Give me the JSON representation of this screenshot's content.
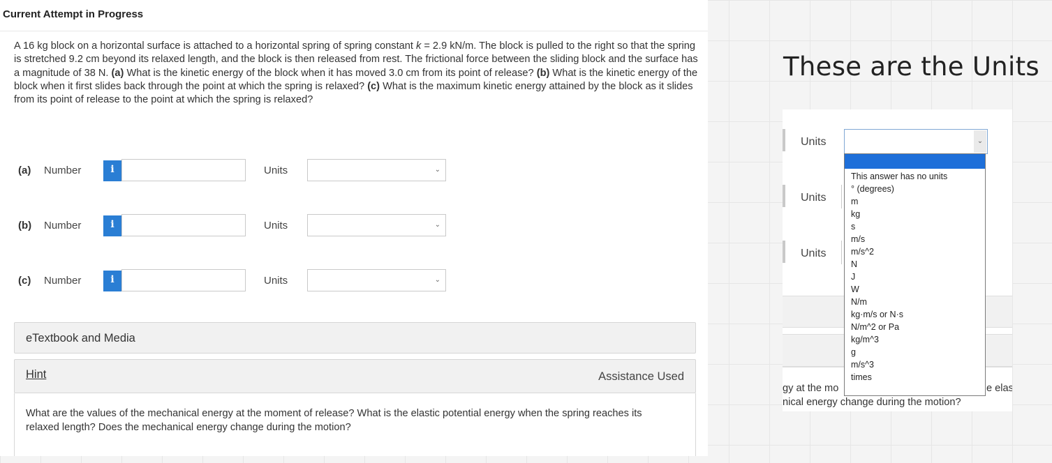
{
  "title": "Current Attempt in Progress",
  "problem": {
    "p1": "A 16 kg block on a horizontal surface is attached to a horizontal spring of spring constant ",
    "k_var": "k",
    "p2": " = 2.9 kN/m. The block is pulled to the right so that the spring is stretched 9.2 cm beyond its relaxed length, and the block is then released from rest. The frictional force between the sliding block and the surface has a magnitude of 38 N. ",
    "a_mark": "(a)",
    "a_text": " What is the kinetic energy of the block when it has moved 3.0 cm from its point of release? ",
    "b_mark": "(b)",
    "b_text": " What is the kinetic energy of the block when it first slides back through the point at which the spring is relaxed? ",
    "c_mark": "(c)",
    "c_text": " What is the maximum kinetic energy attained by the block as it slides from its point of release to the point at which the spring is relaxed?"
  },
  "parts": [
    {
      "letter": "(a)",
      "number_label": "Number",
      "info_icon": "i",
      "number_value": "",
      "units_label": "Units",
      "units_value": ""
    },
    {
      "letter": "(b)",
      "number_label": "Number",
      "info_icon": "i",
      "number_value": "",
      "units_label": "Units",
      "units_value": ""
    },
    {
      "letter": "(c)",
      "number_label": "Number",
      "info_icon": "i",
      "number_value": "",
      "units_label": "Units",
      "units_value": ""
    }
  ],
  "etextbook": {
    "label": "eTextbook and Media"
  },
  "hint": {
    "label": "Hint",
    "status": "Assistance Used",
    "text": "What are the values of the mechanical energy at the moment of release? What is the elastic potential energy when the spring reaches its relaxed length? Does the mechanical energy change during the motion?"
  },
  "zoom": {
    "heading": "These are the Units",
    "units_label": "Units",
    "frag_left_1": "gy at the mo",
    "frag_right_1": "e elas",
    "frag_2": "nical energy change during the motion?"
  },
  "dropdown": {
    "selected": "",
    "options": [
      "This answer has no units",
      "° (degrees)",
      "m",
      "kg",
      "s",
      "m/s",
      "m/s^2",
      "N",
      "J",
      "W",
      "N/m",
      "kg·m/s or N·s",
      "N/m^2 or Pa",
      "kg/m^3",
      "g",
      "m/s^3",
      "times"
    ]
  },
  "colors": {
    "info_button": "#2a7ed4",
    "dropdown_highlight": "#1e6fd9",
    "panel_gray": "#f1f1f1"
  }
}
